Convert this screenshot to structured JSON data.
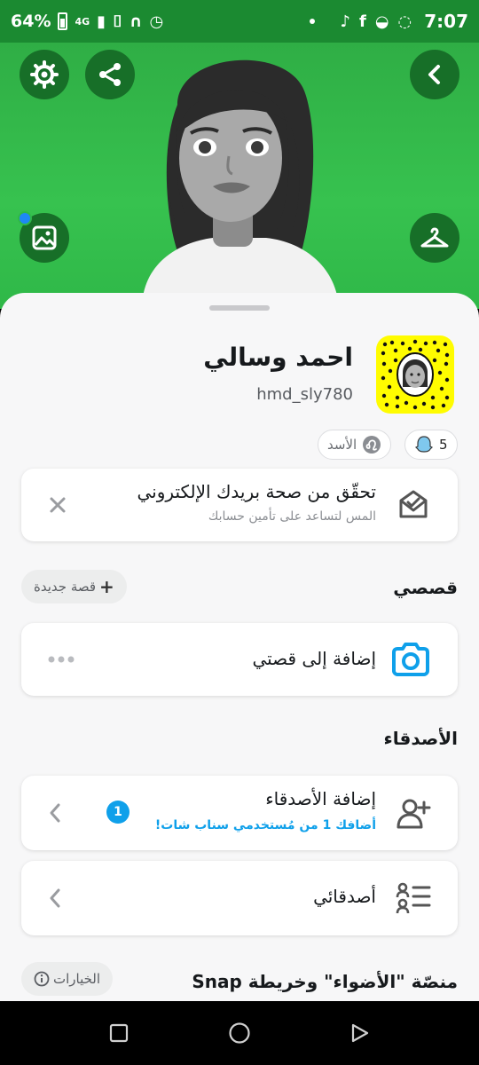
{
  "status_bar": {
    "battery": "64%",
    "network": "4G",
    "time": "7:07",
    "icons": [
      "battery-icon",
      "signal-icon",
      "vibrate-icon",
      "headset-icon",
      "alarm-icon",
      "tiktok-icon",
      "facebook-icon",
      "messenger-icon",
      "whatsapp-icon"
    ]
  },
  "header": {
    "bg_color": "#36bf4d",
    "buttons": [
      "settings-icon",
      "share-icon",
      "back-icon",
      "photo-icon",
      "hanger-icon"
    ]
  },
  "profile": {
    "display_name": "احمد وسالي",
    "username": "hmd_sly780",
    "snapscore": "5",
    "zodiac": "الأسد"
  },
  "email_card": {
    "title": "تحقّق من صحة بريدك الإلكتروني",
    "subtitle": "المس لتساعد على تأمين حسابك"
  },
  "stories": {
    "section_title": "قصصي",
    "new_story_label": "قصة جديدة",
    "add_to_story_label": "إضافة إلى قصتي"
  },
  "friends": {
    "section_title": "الأصدقاء",
    "add_friends_title": "إضافة الأصدقاء",
    "add_friends_subtitle": "أضافك 1 من مُستخدمي سناب شات!",
    "add_friends_badge": "1",
    "my_friends_title": "أصدقائي"
  },
  "spotlight": {
    "section_title": "منصّة \"الأضواء\" وخريطة Snap",
    "options_label": "الخيارات"
  },
  "colors": {
    "accent_blue": "#0fa0ea",
    "snap_yellow": "#fffc00"
  }
}
